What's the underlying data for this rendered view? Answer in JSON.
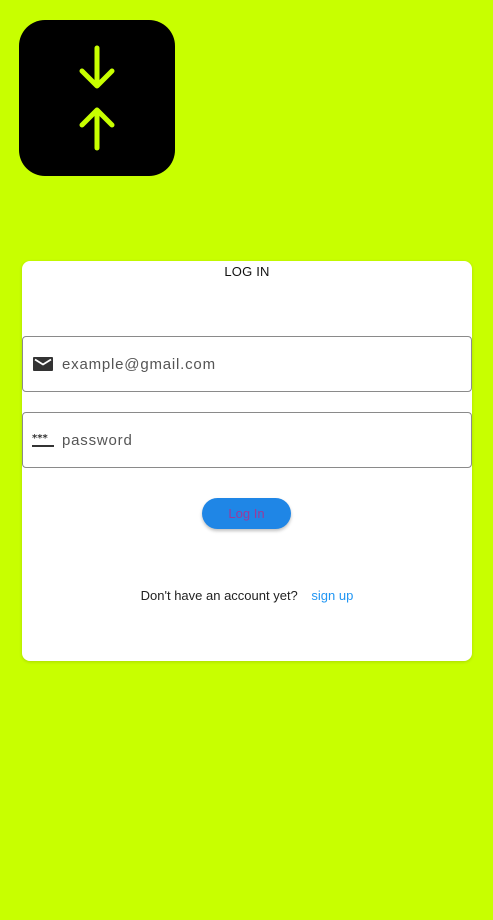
{
  "logo": {
    "icon": "vertical-align-center-icon",
    "background": "#000000",
    "accent": "#c8ff00"
  },
  "page": {
    "background": "#c8ff00"
  },
  "login": {
    "title": "LOG IN",
    "email": {
      "icon": "email-icon",
      "placeholder": "example@gmail.com",
      "value": ""
    },
    "password": {
      "icon": "password-icon",
      "placeholder": "password",
      "value": ""
    },
    "button_label": "Log In",
    "button_color": "#1f86e6",
    "signup_prompt": "Don't have an account yet?",
    "signup_link": "sign up",
    "link_color": "#2196f3"
  }
}
